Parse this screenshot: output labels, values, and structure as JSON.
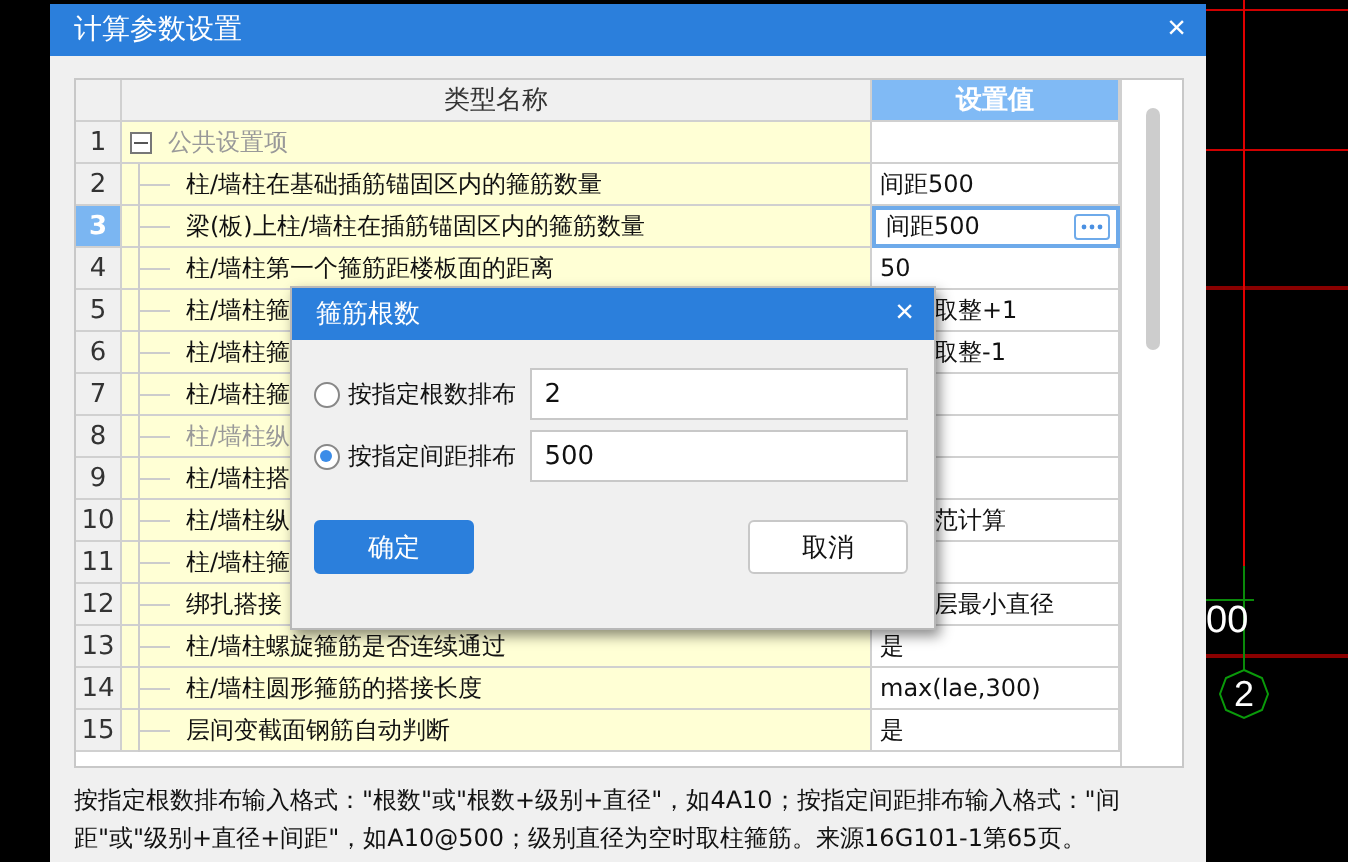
{
  "window": {
    "title": "计算参数设置",
    "close": "×"
  },
  "table": {
    "columns": [
      {
        "label": "类型名称",
        "selected": false
      },
      {
        "label": "设置值",
        "selected": true
      }
    ],
    "rows": [
      {
        "number": "1",
        "kind": "group",
        "name": "公共设置项",
        "expanded": true,
        "disabled": true,
        "selected": false
      },
      {
        "number": "2",
        "kind": "item",
        "name": "柱/墙柱在基础插筋锚固区内的箍筋数量",
        "value": "间距500",
        "disabled": false,
        "selected": false
      },
      {
        "number": "3",
        "kind": "item",
        "name": "梁(板)上柱/墙柱在插筋锚固区内的箍筋数量",
        "value": "间距500",
        "disabled": false,
        "selected": true
      },
      {
        "number": "4",
        "kind": "item",
        "name": "柱/墙柱第一个箍筋距楼板面的距离",
        "value": "50",
        "disabled": false,
        "selected": false
      },
      {
        "number": "5",
        "kind": "item",
        "name": "柱/墙柱箍",
        "value": "取整+1",
        "value_covered": true,
        "disabled": false,
        "selected": false
      },
      {
        "number": "6",
        "kind": "item",
        "name": "柱/墙柱箍",
        "value": "取整-1",
        "value_covered": true,
        "disabled": false,
        "selected": false
      },
      {
        "number": "7",
        "kind": "item",
        "name": "柱/墙柱箍",
        "disabled": false,
        "selected": false
      },
      {
        "number": "8",
        "kind": "item",
        "name": "柱/墙柱纵",
        "disabled": true,
        "selected": false
      },
      {
        "number": "9",
        "kind": "item",
        "name": "柱/墙柱搭",
        "disabled": false,
        "selected": false
      },
      {
        "number": "10",
        "kind": "item",
        "name": "柱/墙柱纵",
        "value": "范计算",
        "value_covered": true,
        "disabled": false,
        "selected": false
      },
      {
        "number": "11",
        "kind": "item",
        "name": "柱/墙柱箍",
        "disabled": false,
        "selected": false
      },
      {
        "number": "12",
        "kind": "item",
        "name": "绑扎搭接",
        "value": "层最小直径",
        "value_covered": true,
        "disabled": false,
        "selected": false
      },
      {
        "number": "13",
        "kind": "item",
        "name": "柱/墙柱螺旋箍筋是否连续通过",
        "value": "是",
        "disabled": false,
        "selected": false
      },
      {
        "number": "14",
        "kind": "item",
        "name": "柱/墙柱圆形箍筋的搭接长度",
        "value": "max(lae,300)",
        "disabled": false,
        "selected": false
      },
      {
        "number": "15",
        "kind": "item",
        "name": "层间变截面钢筋自动判断",
        "value": "是",
        "disabled": false,
        "selected": false
      }
    ]
  },
  "hint": "按指定根数排布输入格式：\"根数\"或\"根数+级别+直径\"，如4A10；按指定间距排布输入格式：\"间距\"或\"级别+直径+间距\"，如A10@500；级别直径为空时取柱箍筋。来源16G101-1第65页。",
  "dialog": {
    "title": "箍筋根数",
    "close": "×",
    "options": [
      {
        "label": "按指定根数排布",
        "selected": false,
        "value": "2"
      },
      {
        "label": "按指定间距排布",
        "selected": true,
        "value": "500"
      }
    ],
    "buttons": [
      {
        "label": "确定",
        "primary": true
      },
      {
        "label": "取消",
        "primary": false
      }
    ]
  },
  "canvas": {
    "dimension": "00",
    "axis_marker": "2"
  }
}
